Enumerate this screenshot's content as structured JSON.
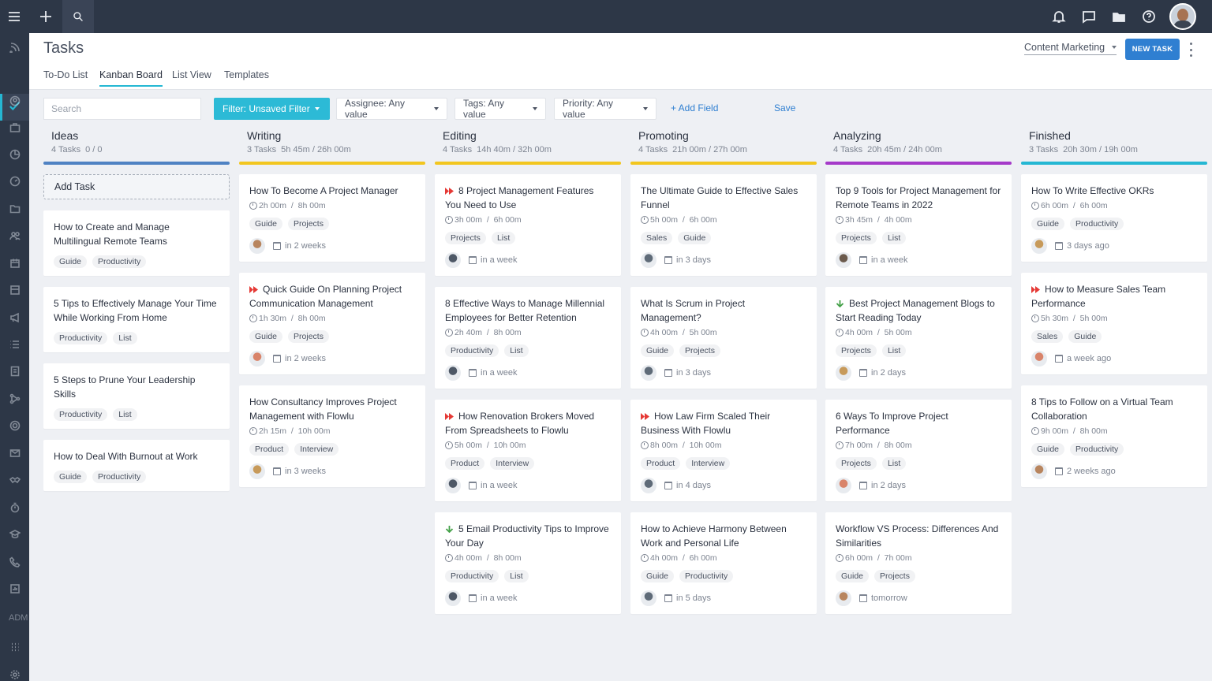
{
  "app": {
    "title": "Tasks"
  },
  "tabs": [
    {
      "label": "To-Do List"
    },
    {
      "label": "Kanban Board"
    },
    {
      "label": "List View"
    },
    {
      "label": "Templates"
    }
  ],
  "header": {
    "project": "Content Marketing",
    "new_task": "NEW TASK"
  },
  "sidebar": {
    "admin_label": "ADM"
  },
  "filters": {
    "search_placeholder": "Search",
    "filter": "Filter: Unsaved Filter",
    "assignee": "Assignee: Any value",
    "tags": "Tags: Any value",
    "priority": "Priority: Any value",
    "add_field": "+ Add Field",
    "save": "Save"
  },
  "colors": {
    "accent": "#2cbad6",
    "primary": "#2f7fd1",
    "sidebar": "#2d3747",
    "priority_high": "#e53935",
    "priority_low": "#43a047"
  },
  "columns": [
    {
      "title": "Ideas",
      "count": "4 Tasks",
      "time": "0 / 0",
      "color": "#4f82c3",
      "add_task": "Add Task",
      "cards": [
        {
          "title": "How to Create and Manage Multilingual Remote Teams",
          "tags": [
            "Guide",
            "Productivity"
          ]
        },
        {
          "title": "5 Tips to Effectively Manage Your Time While Working From Home",
          "tags": [
            "Productivity",
            "List"
          ]
        },
        {
          "title": "5 Steps to Prune Your Leadership Skills",
          "tags": [
            "Productivity",
            "List"
          ]
        },
        {
          "title": "How to Deal With Burnout at Work",
          "tags": [
            "Guide",
            "Productivity"
          ]
        }
      ]
    },
    {
      "title": "Writing",
      "count": "3 Tasks",
      "time": "5h 45m / 26h 00m",
      "color": "#f2c61f",
      "cards": [
        {
          "title": "How To Become A Project Manager",
          "time": "2h 00m  /  8h 00m",
          "tags": [
            "Guide",
            "Projects"
          ],
          "due": "in 2 weeks",
          "avatar": "#b8855e"
        },
        {
          "title": "Quick Guide On Planning Project Communication Management",
          "priority": "high",
          "time": "1h 30m  /  8h 00m",
          "tags": [
            "Guide",
            "Projects"
          ],
          "due": "in 2 weeks",
          "avatar": "#d9846a"
        },
        {
          "title": "How Consultancy Improves Project Management with Flowlu",
          "time": "2h 15m  /  10h 00m",
          "tags": [
            "Product",
            "Interview"
          ],
          "due": "in 3 weeks",
          "avatar": "#c79a5a"
        }
      ]
    },
    {
      "title": "Editing",
      "count": "4 Tasks",
      "time": "14h 40m / 32h 00m",
      "color": "#f2c61f",
      "cards": [
        {
          "title": "8 Project Management Features You Need to Use",
          "priority": "high",
          "time": "3h 00m  /  6h 00m",
          "tags": [
            "Projects",
            "List"
          ],
          "due": "in a week",
          "avatar": "#4e5866"
        },
        {
          "title": "8 Effective Ways to Manage Millennial Employees for Better Retention",
          "time": "2h 40m  /  8h 00m",
          "tags": [
            "Productivity",
            "List"
          ],
          "due": "in a week",
          "avatar": "#4e5866"
        },
        {
          "title": "How Renovation Brokers Moved From Spreadsheets to Flowlu",
          "priority": "high",
          "time": "5h 00m  /  10h 00m",
          "tags": [
            "Product",
            "Interview"
          ],
          "due": "in a week",
          "avatar": "#4e5866"
        },
        {
          "title": "5 Email Productivity Tips to Improve Your Day",
          "priority": "low",
          "time": "4h 00m  /  8h 00m",
          "tags": [
            "Productivity",
            "List"
          ],
          "due": "in a week",
          "avatar": "#4e5866"
        }
      ]
    },
    {
      "title": "Promoting",
      "count": "4 Tasks",
      "time": "21h 00m / 27h 00m",
      "color": "#f2c61f",
      "cards": [
        {
          "title": "The Ultimate Guide to Effective Sales Funnel",
          "time": "5h 00m  /  6h 00m",
          "tags": [
            "Sales",
            "Guide"
          ],
          "due": "in 3 days",
          "avatar": "#5f6b78"
        },
        {
          "title": "What Is Scrum in Project Management?",
          "time": "4h 00m  /  5h 00m",
          "tags": [
            "Guide",
            "Projects"
          ],
          "due": "in 3 days",
          "avatar": "#5f6b78"
        },
        {
          "title": "How Law Firm Scaled Their Business With Flowlu",
          "priority": "high",
          "time": "8h 00m  /  10h 00m",
          "tags": [
            "Product",
            "Interview"
          ],
          "due": "in 4 days",
          "avatar": "#5f6b78"
        },
        {
          "title": "How to Achieve Harmony Between Work and Personal Life",
          "time": "4h 00m  /  6h 00m",
          "tags": [
            "Guide",
            "Productivity"
          ],
          "due": "in 5 days",
          "avatar": "#5f6b78"
        }
      ]
    },
    {
      "title": "Analyzing",
      "count": "4 Tasks",
      "time": "20h 45m / 24h 00m",
      "color": "#a53ac9",
      "cards": [
        {
          "title": "Top 9 Tools for Project Management for Remote Teams in 2022",
          "time": "3h 45m  /  4h 00m",
          "tags": [
            "Projects",
            "List"
          ],
          "due": "in a week",
          "avatar": "#6b5a4c"
        },
        {
          "title": "Best Project Management Blogs to Start Reading Today",
          "priority": "low",
          "time": "4h 00m  /  5h 00m",
          "tags": [
            "Projects",
            "List"
          ],
          "due": "in 2 days",
          "avatar": "#c79a5a"
        },
        {
          "title": "6 Ways To Improve Project Performance",
          "time": "7h 00m  /  8h 00m",
          "tags": [
            "Projects",
            "List"
          ],
          "due": "in 2 days",
          "avatar": "#d9846a"
        },
        {
          "title": "Workflow VS Process: Differences And Similarities",
          "time": "6h 00m  /  7h 00m",
          "tags": [
            "Guide",
            "Projects"
          ],
          "due": "tomorrow",
          "avatar": "#b8855e"
        }
      ]
    },
    {
      "title": "Finished",
      "count": "3 Tasks",
      "time": "20h 30m / 19h 00m",
      "color": "#25b7d3",
      "cards": [
        {
          "title": "How To Write Effective OKRs",
          "time": "6h 00m  /  6h 00m",
          "tags": [
            "Guide",
            "Productivity"
          ],
          "due": "3 days ago",
          "avatar": "#c79a5a"
        },
        {
          "title": "How to Measure Sales Team Performance",
          "priority": "high",
          "time": "5h 30m  /  5h 00m",
          "tags": [
            "Sales",
            "Guide"
          ],
          "due": "a week ago",
          "avatar": "#d9846a"
        },
        {
          "title": "8 Tips to Follow on a Virtual Team Collaboration",
          "time": "9h 00m  /  8h 00m",
          "tags": [
            "Guide",
            "Productivity"
          ],
          "due": "2 weeks ago",
          "avatar": "#b8855e"
        }
      ]
    }
  ]
}
